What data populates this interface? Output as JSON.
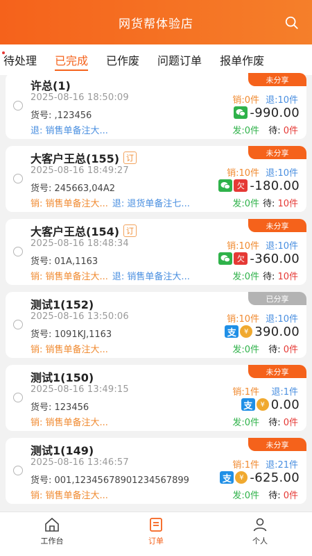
{
  "header": {
    "title": "网货帮体验店"
  },
  "tabs": [
    {
      "label": "待处理"
    },
    {
      "label": "已完成"
    },
    {
      "label": "已作废"
    },
    {
      "label": "问题订单"
    },
    {
      "label": "报单作废"
    }
  ],
  "orders": [
    {
      "badge": "未分享",
      "name": "许总(1)",
      "time": "2025-08-16 18:50:09",
      "goods": "货号: ,123456",
      "xiao": "销:0件",
      "tui": "退:10件",
      "amount": "-990.00",
      "fa": "发:0件",
      "dai_label": "待: ",
      "dai_n": "0件",
      "remark_ret": "退: 销售单备注大..."
    },
    {
      "badge": "未分享",
      "name": "大客户王总(155)",
      "ding": "订",
      "time": "2025-08-16 18:49:27",
      "goods": "货号: 245663,04A2",
      "xiao": "销:10件",
      "tui": "退:10件",
      "qian": "欠",
      "amount": "-180.00",
      "fa": "发:0件",
      "dai_label": "待: ",
      "dai_n": "10件",
      "remark_sale": "销: 销售单备注大...",
      "remark_ret": "退: 退货单备注七..."
    },
    {
      "badge": "未分享",
      "name": "大客户王总(154)",
      "ding": "订",
      "time": "2025-08-16 18:48:34",
      "goods": "货号: 01A,1163",
      "xiao": "销:10件",
      "tui": "退:10件",
      "qian": "欠",
      "amount": "-360.00",
      "fa": "发:0件",
      "dai_label": "待: ",
      "dai_n": "10件",
      "remark_sale": "销: 销售单备注大...",
      "remark_ret": "退: 销售单备注大..."
    },
    {
      "badge": "已分享",
      "name": "测试1(152)",
      "time": "2025-08-16 13:50:06",
      "goods": "货号: 1091KJ,1163",
      "xiao": "销:10件",
      "tui": "退:10件",
      "alipay": "支",
      "cash": "¥",
      "amount": "390.00",
      "fa": "发:0件",
      "dai_label": "待: ",
      "dai_n": "0件",
      "remark_sale": "销: 销售单备注大..."
    },
    {
      "badge": "未分享",
      "name": "测试1(150)",
      "time": "2025-08-16 13:49:15",
      "goods": "货号: 123456",
      "xiao": "销:1件",
      "tui": "退:1件",
      "alipay": "支",
      "cash": "¥",
      "amount": "0.00",
      "fa": "发:0件",
      "dai_label": "待: ",
      "dai_n": "0件",
      "remark_sale": "销: 销售单备注大..."
    },
    {
      "badge": "未分享",
      "name": "测试1(149)",
      "time": "2025-08-16 13:46:57",
      "goods": "货号: 001,12345678901234567899",
      "xiao": "销:1件",
      "tui": "退:21件",
      "alipay": "支",
      "cash": "¥",
      "amount": "-625.00",
      "fa": "发:0件",
      "dai_label": "待: ",
      "dai_n": "0件",
      "remark_sale": "销: 销售单备注大..."
    }
  ],
  "tabbar": [
    {
      "label": "工作台"
    },
    {
      "label": "订单"
    },
    {
      "label": "个人"
    }
  ],
  "colors": {
    "accent": "#f5621b",
    "blue": "#4a8fe0",
    "green": "#2fb24a",
    "red": "#e53935"
  }
}
